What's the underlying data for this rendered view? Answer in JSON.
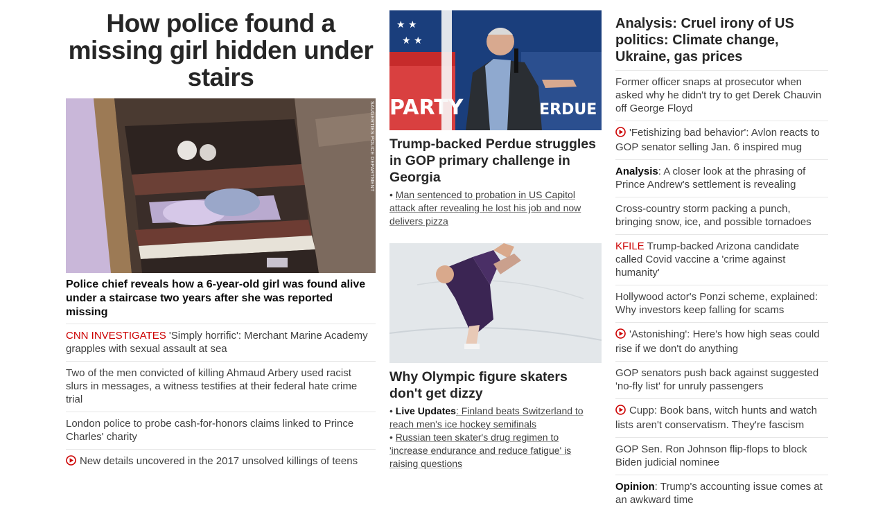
{
  "col1": {
    "hero_title": "How police found a missing girl hidden under stairs",
    "photo_credit": "SAUGERTIES POLICE DEPARTMENT",
    "hero_headline": "Police chief reveals how a 6-year-old girl was found alive under a staircase two years after she was reported missing",
    "items": [
      {
        "kicker": "CNN INVESTIGATES",
        "text": " 'Simply horrific': Merchant Marine Academy grapples with sexual assault at sea"
      },
      {
        "text": "Two of the men convicted of killing Ahmaud Arbery used racist slurs in messages, a witness testifies at their federal hate crime trial"
      },
      {
        "text": "London police to probe cash-for-honors claims linked to Prince Charles' charity"
      },
      {
        "video": true,
        "text": "New details uncovered in the 2017 unsolved killings of teens"
      }
    ]
  },
  "col2": {
    "headline1": "Trump-backed Perdue struggles in GOP primary challenge in Georgia",
    "sub1": [
      "Man sentenced to probation in US Capitol attack after revealing he lost his job and now delivers pizza"
    ],
    "headline2": "Why Olympic figure skaters don't get dizzy",
    "sub2": [
      {
        "bold": "Live Updates",
        "text": ": Finland beats Switzerland to reach men's ice hockey semifinals"
      },
      {
        "text": "Russian teen skater's drug regimen to 'increase endurance and reduce fatigue' is raising questions"
      }
    ],
    "img1_sign_left": "PARTY",
    "img1_sign_right": "PERDUE"
  },
  "col3": {
    "headline": "Analysis: Cruel irony of US politics: Climate change, Ukraine, gas prices",
    "items": [
      {
        "text": "Former officer snaps at prosecutor when asked why he didn't try to get Derek Chauvin off George Floyd"
      },
      {
        "video": true,
        "text": "'Fetishizing bad behavior': Avlon reacts to GOP senator selling Jan. 6 inspired mug"
      },
      {
        "bold": "Analysis",
        "text": ": A closer look at the phrasing of Prince Andrew's settlement is revealing"
      },
      {
        "text": "Cross-country storm packing a punch, bringing snow, ice, and possible tornadoes"
      },
      {
        "kicker": "KFILE",
        "text": " Trump-backed Arizona candidate called Covid vaccine a 'crime against humanity'"
      },
      {
        "text": "Hollywood actor's Ponzi scheme, explained: Why investors keep falling for scams"
      },
      {
        "video": true,
        "text": "'Astonishing': Here's how high seas could rise if we don't do anything"
      },
      {
        "text": "GOP senators push back against suggested 'no-fly list' for unruly passengers"
      },
      {
        "video": true,
        "text": "Cupp: Book bans, witch hunts and watch lists aren't conservatism. They're fascism"
      },
      {
        "text": "GOP Sen. Ron Johnson flip-flops to block Biden judicial nominee"
      },
      {
        "bold": "Opinion",
        "text": ": Trump's accounting issue comes at an awkward time"
      }
    ]
  },
  "colors": {
    "kicker": "#cc0000",
    "text": "#404040",
    "headline": "#262626",
    "divider": "#e6e6e6"
  },
  "icons": {
    "video": "play-circle-icon"
  }
}
